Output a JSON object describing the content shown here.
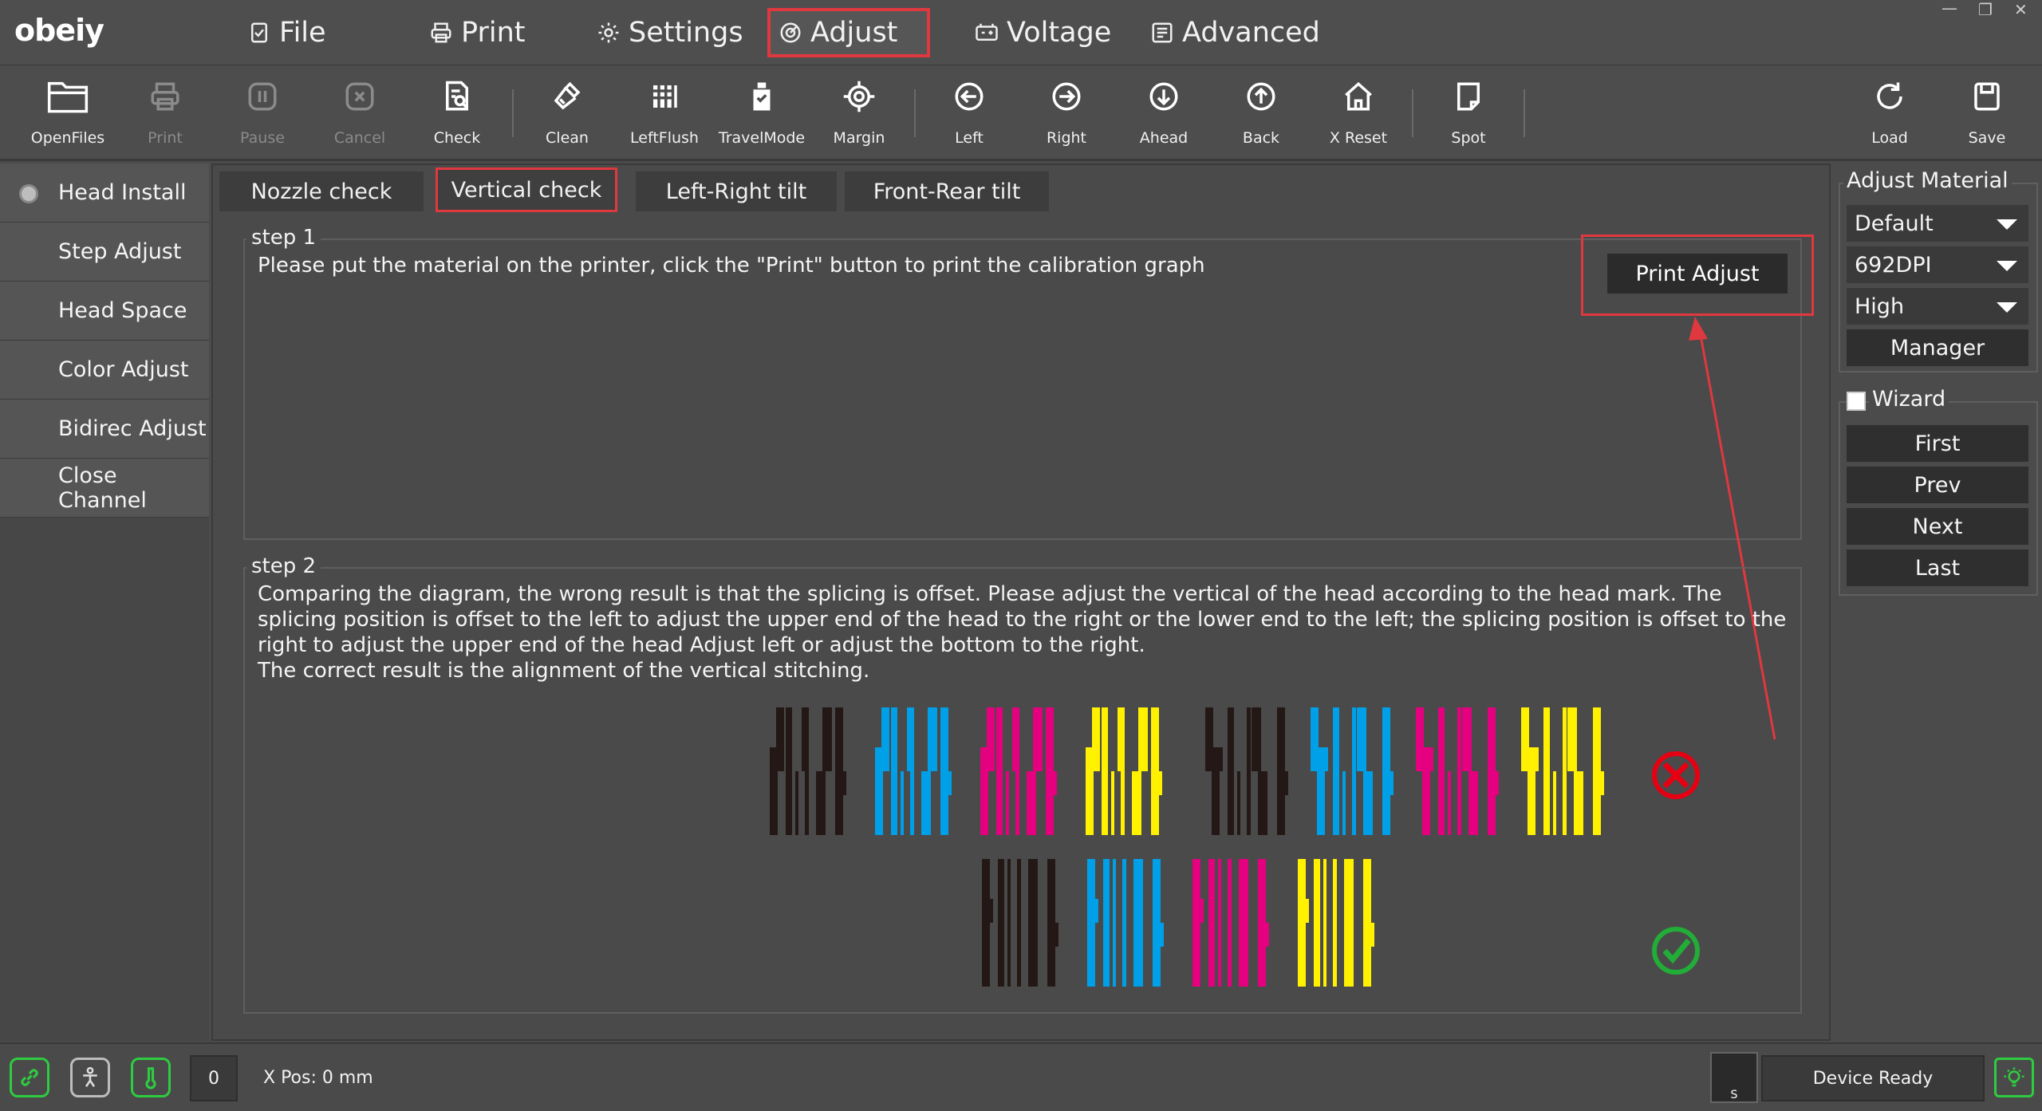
{
  "app": {
    "logo": "obeiy"
  },
  "menu": {
    "items": [
      {
        "label": "File",
        "icon": "file-icon"
      },
      {
        "label": "Print",
        "icon": "printer-icon"
      },
      {
        "label": "Settings",
        "icon": "gear-icon"
      },
      {
        "label": "Adjust",
        "icon": "adjust-icon",
        "active": true
      },
      {
        "label": "Voltage",
        "icon": "battery-icon"
      },
      {
        "label": "Advanced",
        "icon": "advanced-icon"
      }
    ]
  },
  "window_controls": {
    "minimize": "—",
    "restore": "❐",
    "close": "✕"
  },
  "toolbar": {
    "items": [
      {
        "label": "OpenFiles",
        "icon": "folder-icon",
        "enabled": true
      },
      {
        "label": "Print",
        "icon": "printer-icon",
        "enabled": false
      },
      {
        "label": "Pause",
        "icon": "pause-icon",
        "enabled": false
      },
      {
        "label": "Cancel",
        "icon": "cancel-icon",
        "enabled": false
      },
      {
        "label": "Check",
        "icon": "check-doc-icon",
        "enabled": true
      },
      {
        "label": "Clean",
        "icon": "brush-icon",
        "enabled": true
      },
      {
        "label": "LeftFlush",
        "icon": "grid-icon",
        "enabled": true
      },
      {
        "label": "TravelMode",
        "icon": "bottle-icon",
        "enabled": true
      },
      {
        "label": "Margin",
        "icon": "target-icon",
        "enabled": true
      },
      {
        "label": "Left",
        "icon": "arrow-left-icon",
        "enabled": true
      },
      {
        "label": "Right",
        "icon": "arrow-right-icon",
        "enabled": true
      },
      {
        "label": "Ahead",
        "icon": "arrow-down-icon",
        "enabled": true
      },
      {
        "label": "Back",
        "icon": "arrow-up-icon",
        "enabled": true
      },
      {
        "label": "X Reset",
        "icon": "home-icon",
        "enabled": true
      },
      {
        "label": "Spot",
        "icon": "spot-icon",
        "enabled": true
      },
      {
        "label": "Load",
        "icon": "refresh-icon",
        "enabled": true
      },
      {
        "label": "Save",
        "icon": "save-icon",
        "enabled": true
      }
    ]
  },
  "sidebar": {
    "items": [
      {
        "label": "Head Install",
        "selected": true
      },
      {
        "label": "Step Adjust"
      },
      {
        "label": "Head Space"
      },
      {
        "label": "Color Adjust"
      },
      {
        "label": "Bidirec Adjust"
      },
      {
        "label": "Close Channel"
      }
    ]
  },
  "tabs": [
    {
      "label": "Nozzle check"
    },
    {
      "label": "Vertical check",
      "active": true
    },
    {
      "label": "Left-Right tilt"
    },
    {
      "label": "Front-Rear tilt"
    }
  ],
  "step1": {
    "title": "step 1",
    "text": "Please put the material on the printer, click the \"Print\" button to print the calibration graph",
    "button": "Print Adjust"
  },
  "step2": {
    "title": "step 2",
    "text1": "Comparing the diagram, the wrong result is that the splicing is offset. Please adjust the vertical of the head according to the head mark. The splicing position is offset to the left to adjust the upper end of the head to the right or the lower end to the left; the splicing position is offset to the right to adjust the upper end of the head Adjust left or adjust the bottom to the right.",
    "text2": "The correct result is the alignment of the vertical stitching."
  },
  "diagram_colors": {
    "black": "#231815",
    "cyan": "#00a0e9",
    "magenta": "#e4007f",
    "yellow": "#fff100",
    "wrong": "#e60012",
    "correct": "#22ac38"
  },
  "right_panel": {
    "material_title": "Adjust Material",
    "selects": [
      "Default",
      "692DPI",
      "High"
    ],
    "manager": "Manager",
    "wizard_label": "Wizard",
    "wizard_buttons": [
      "First",
      "Prev",
      "Next",
      "Last"
    ]
  },
  "status": {
    "counter": "0",
    "xpos": "X Pos: 0 mm",
    "media_label": "S",
    "state": "Device Ready"
  },
  "colors": {
    "accent_red": "#e0383f",
    "status_green": "#2ecc40"
  }
}
